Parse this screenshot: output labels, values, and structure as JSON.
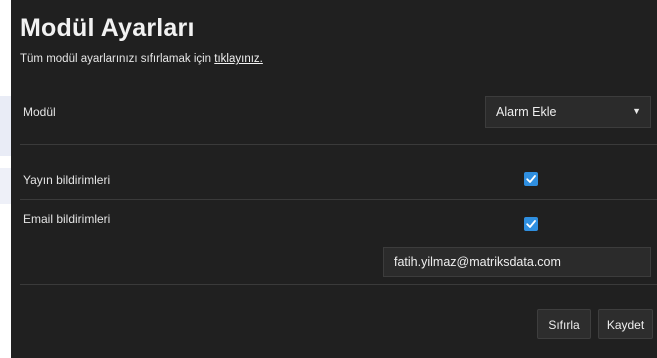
{
  "page": {
    "title": "Modül Ayarları",
    "reset_text": "Tüm modül ayarlarınızı sıfırlamak için ",
    "reset_link": "tıklayınız."
  },
  "module": {
    "label": "Modül",
    "selected": "Alarm Ekle"
  },
  "notifications": {
    "broadcast_label": "Yayın bildirimleri",
    "broadcast_checked": true,
    "email_label": "Email bildirimleri",
    "email_checked": true,
    "email_value": "fatih.yilmaz@matriksdata.com"
  },
  "buttons": {
    "reset": "Sıfırla",
    "save": "Kaydet"
  },
  "colors": {
    "panel_bg": "#202020",
    "checkbox_accent": "#2f8fe0"
  },
  "icons": {
    "dropdown": "caret-down-icon",
    "check": "checkmark-icon"
  }
}
